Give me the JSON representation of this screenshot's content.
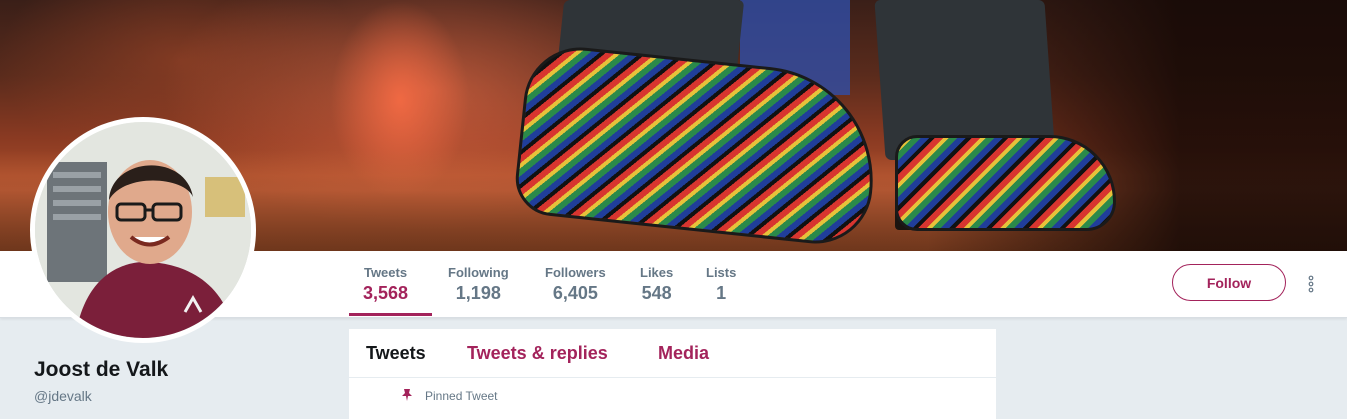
{
  "profile": {
    "name": "Joost de Valk",
    "handle": "@jdevalk"
  },
  "stats": [
    {
      "label": "Tweets",
      "value": "3,568",
      "active": true
    },
    {
      "label": "Following",
      "value": "1,198",
      "active": false
    },
    {
      "label": "Followers",
      "value": "6,405",
      "active": false
    },
    {
      "label": "Likes",
      "value": "548",
      "active": false
    },
    {
      "label": "Lists",
      "value": "1",
      "active": false
    }
  ],
  "actions": {
    "follow_label": "Follow",
    "more_icon": "more-vertical-icon"
  },
  "timeline": {
    "tabs": [
      "Tweets",
      "Tweets & replies",
      "Media"
    ],
    "active_tab": "Tweets",
    "pinned_label": "Pinned Tweet",
    "pinned_icon": "pin-icon"
  },
  "colors": {
    "accent": "#a3235b",
    "muted": "#657786",
    "text": "#14171a",
    "background": "#e6ecf0"
  }
}
